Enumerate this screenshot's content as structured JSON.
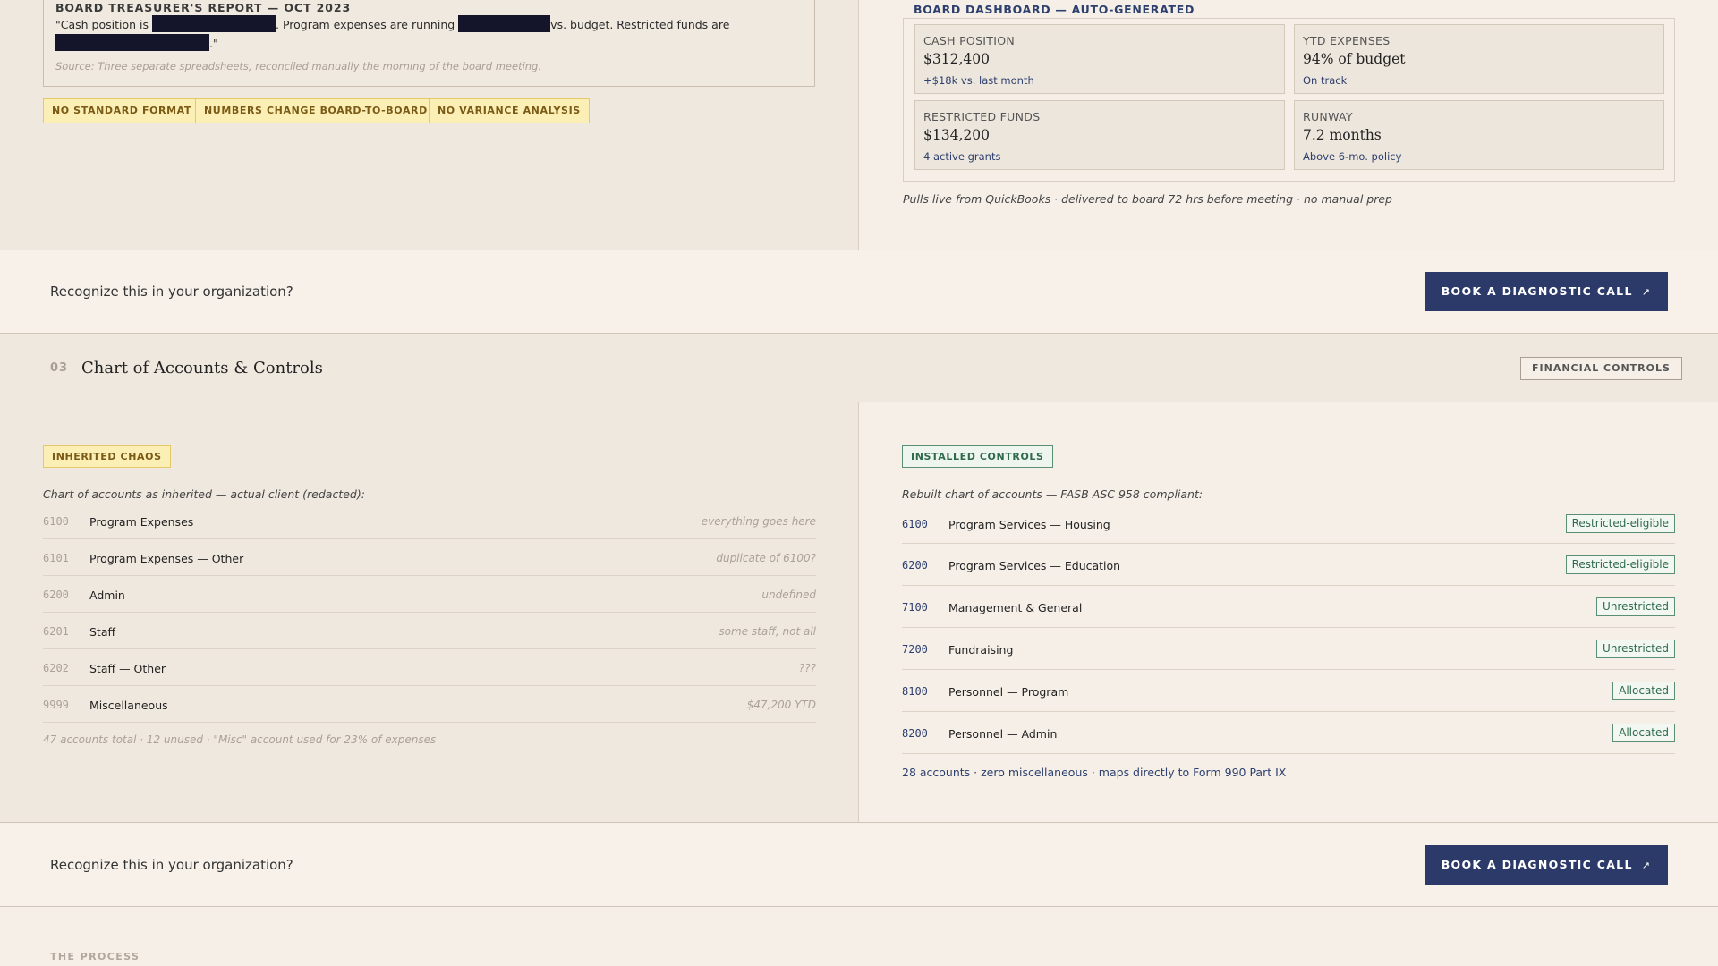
{
  "top": {
    "report": {
      "title": "BOARD TREASURER'S REPORT — OCT 2023",
      "line_part1": "\"Cash position is ",
      "line_part2": ". Program expenses are running ",
      "line_part3": "vs. budget. Restricted funds are",
      "line_part4": ".\"",
      "source": "Source: Three separate spreadsheets, reconciled manually the morning of the board meeting."
    },
    "tags": [
      "NO STANDARD FORMAT",
      "NUMBERS CHANGE BOARD-TO-BOARD",
      "NO VARIANCE ANALYSIS"
    ],
    "dashboard": {
      "title": "BOARD DASHBOARD — AUTO-GENERATED",
      "cards": [
        {
          "label": "CASH POSITION",
          "value": "$312,400",
          "sub": "+$18k vs. last month"
        },
        {
          "label": "YTD EXPENSES",
          "value": "94% of budget",
          "sub": "On track"
        },
        {
          "label": "RESTRICTED FUNDS",
          "value": "$134,200",
          "sub": "4 active grants"
        },
        {
          "label": "RUNWAY",
          "value": "7.2 months",
          "sub": "Above 6-mo. policy"
        }
      ],
      "note": "Pulls live from QuickBooks · delivered to board 72 hrs before meeting · no manual prep"
    }
  },
  "cta": {
    "prompt": "Recognize this in your organization?",
    "button_label": "BOOK A DIAGNOSTIC CALL",
    "button_icon": "↗"
  },
  "section3": {
    "number": "03",
    "title": "Chart of Accounts & Controls",
    "badge": "FINANCIAL CONTROLS"
  },
  "accounts": {
    "left": {
      "tag": "INHERITED CHAOS",
      "intro": "Chart of accounts as inherited — actual client (redacted):",
      "rows": [
        {
          "code": "6100",
          "name": "Program Expenses",
          "note": "everything goes here"
        },
        {
          "code": "6101",
          "name": "Program Expenses — Other",
          "note": "duplicate of 6100?"
        },
        {
          "code": "6200",
          "name": "Admin",
          "note": "undefined"
        },
        {
          "code": "6201",
          "name": "Staff",
          "note": "some staff, not all"
        },
        {
          "code": "6202",
          "name": "Staff — Other",
          "note": "???"
        },
        {
          "code": "9999",
          "name": "Miscellaneous",
          "note": "$47,200 YTD"
        }
      ],
      "footer": "47 accounts total · 12 unused · \"Misc\" account used for 23% of expenses"
    },
    "right": {
      "tag": "INSTALLED CONTROLS",
      "intro": "Rebuilt chart of accounts — FASB ASC 958 compliant:",
      "rows": [
        {
          "code": "6100",
          "name": "Program Services — Housing",
          "pill": "Restricted-eligible"
        },
        {
          "code": "6200",
          "name": "Program Services — Education",
          "pill": "Restricted-eligible"
        },
        {
          "code": "7100",
          "name": "Management & General",
          "pill": "Unrestricted"
        },
        {
          "code": "7200",
          "name": "Fundraising",
          "pill": "Unrestricted"
        },
        {
          "code": "8100",
          "name": "Personnel — Program",
          "pill": "Allocated"
        },
        {
          "code": "8200",
          "name": "Personnel — Admin",
          "pill": "Allocated"
        }
      ],
      "footer": "28 accounts · zero miscellaneous · maps directly to Form 990 Part IX"
    }
  },
  "process_label": "THE PROCESS",
  "colors": {
    "navy": "#2b3a69",
    "warn_bg": "#fbefb6",
    "good": "#2f6a4c",
    "page_bg": "#f5efe7"
  }
}
